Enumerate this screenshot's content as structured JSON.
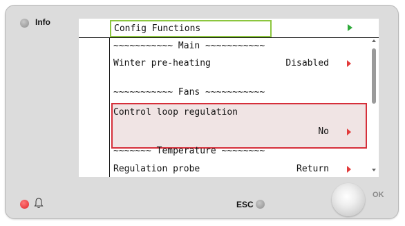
{
  "panel": {
    "info_label": "Info",
    "esc_label": "ESC",
    "ok_label": "OK"
  },
  "screen": {
    "title": "Config Functions",
    "lines": {
      "main_separator": "~~~~~~~~~~~ Main ~~~~~~~~~~~",
      "winter_label": "Winter pre-heating",
      "winter_value": "Disabled",
      "fans_separator": "~~~~~~~~~~~ Fans ~~~~~~~~~~~",
      "control_label": "Control loop regulation",
      "control_value": "No",
      "temp_separator": "~~~~~~~ Temperature ~~~~~~~~",
      "probe_label": "Regulation probe",
      "probe_value": "Return"
    }
  },
  "colors": {
    "title_border": "#8cc63f",
    "selection_border": "#d62f3a",
    "nav_arrow": "#2eaa3a",
    "value_arrow": "#e23b3b",
    "alarm_led": "#e0262b"
  },
  "icons": [
    "info-led-icon",
    "alarm-led-icon",
    "bell-icon",
    "esc-led-icon",
    "ok-knob-icon"
  ]
}
